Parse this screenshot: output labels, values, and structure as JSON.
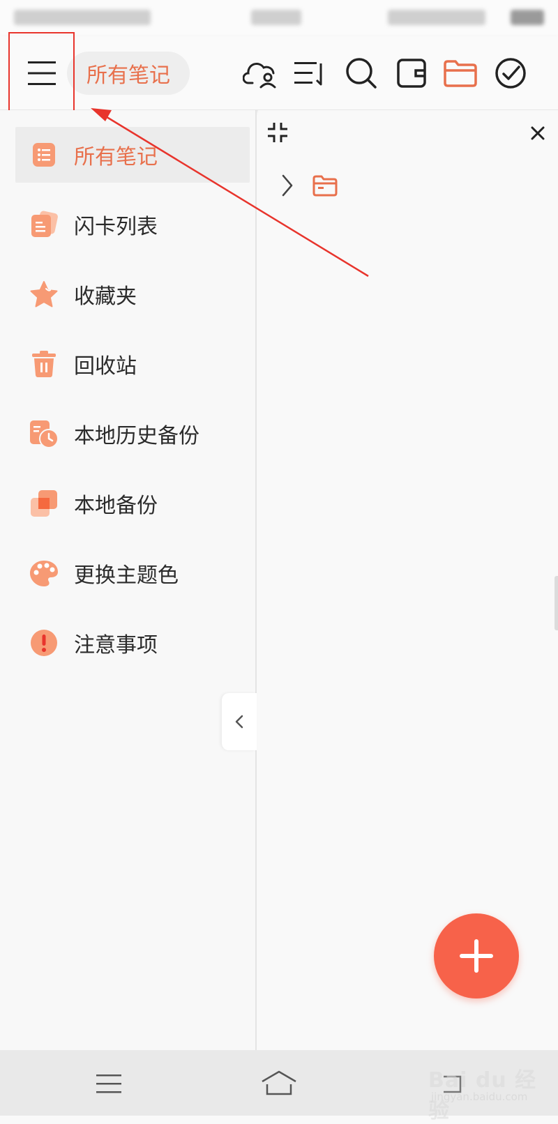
{
  "header": {
    "title": "所有笔记"
  },
  "drawer": {
    "items": [
      {
        "label": "所有笔记",
        "icon": "note-list-icon",
        "active": true
      },
      {
        "label": "闪卡列表",
        "icon": "flashcard-icon",
        "active": false
      },
      {
        "label": "收藏夹",
        "icon": "star-icon",
        "active": false
      },
      {
        "label": "回收站",
        "icon": "trash-icon",
        "active": false
      },
      {
        "label": "本地历史备份",
        "icon": "history-backup-icon",
        "active": false
      },
      {
        "label": "本地备份",
        "icon": "backup-icon",
        "active": false
      },
      {
        "label": "更换主题色",
        "icon": "palette-icon",
        "active": false
      },
      {
        "label": "注意事项",
        "icon": "warning-icon",
        "active": false
      }
    ]
  },
  "watermark": {
    "main": "Bai du 经验",
    "sub": "jingyan.baidu.com"
  },
  "colors": {
    "accent": "#e8704c",
    "icon_orange": "#f79a74",
    "fab": "#f7624a",
    "annotation_red": "#e8342c"
  }
}
